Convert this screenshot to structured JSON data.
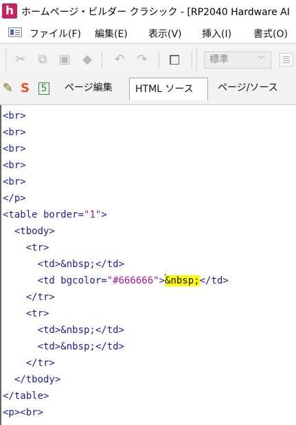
{
  "window": {
    "app_icon_letter": "h",
    "title": "ホームページ・ビルダー クラシック - [RP2040 Hardware AI"
  },
  "menu": {
    "items": [
      "ファイル(F)",
      "編集(E)",
      "表示(V)",
      "挿入(I)",
      "書式(O)"
    ]
  },
  "toolbar": {
    "style_value": "標準"
  },
  "tabs": {
    "items": [
      {
        "label": "ページ編集",
        "active": false
      },
      {
        "label": "HTML ソース",
        "active": true
      },
      {
        "label": "ページ/ソース",
        "active": false
      }
    ]
  },
  "editor": {
    "lines": [
      {
        "text": "<br>"
      },
      {
        "text": "<br>"
      },
      {
        "text": "<br>"
      },
      {
        "text": "<br>"
      },
      {
        "text": "<br>"
      },
      {
        "text": "</p>"
      },
      {
        "text": "<table border=\"1\">"
      },
      {
        "text": "  <tbody>"
      },
      {
        "text": "    <tr>"
      },
      {
        "text": "      <td>&nbsp;</td>"
      },
      {
        "text": "      <td bgcolor=\"#666666\">&nbsp;</td>"
      },
      {
        "text": "    </tr>"
      },
      {
        "text": "    <tr>"
      },
      {
        "text": "      <td>&nbsp;</td>"
      },
      {
        "text": "      <td>&nbsp;</td>"
      },
      {
        "text": "    </tr>"
      },
      {
        "text": "  </tbody>"
      },
      {
        "text": "</table>"
      },
      {
        "text": "<p><br>"
      }
    ]
  },
  "colors": {
    "app_icon": "#c8215f",
    "tag": "#1c1c9a",
    "attribute_value": "#a2179c",
    "selection_highlight": "#ffff00"
  },
  "icons": [
    "app-logo-icon",
    "view-icon",
    "cut-icon",
    "copy-icon",
    "paste-icon",
    "eraser-icon",
    "undo-icon",
    "redo-icon",
    "frame-icon",
    "pen-icon",
    "s-icon",
    "document-icon"
  ]
}
